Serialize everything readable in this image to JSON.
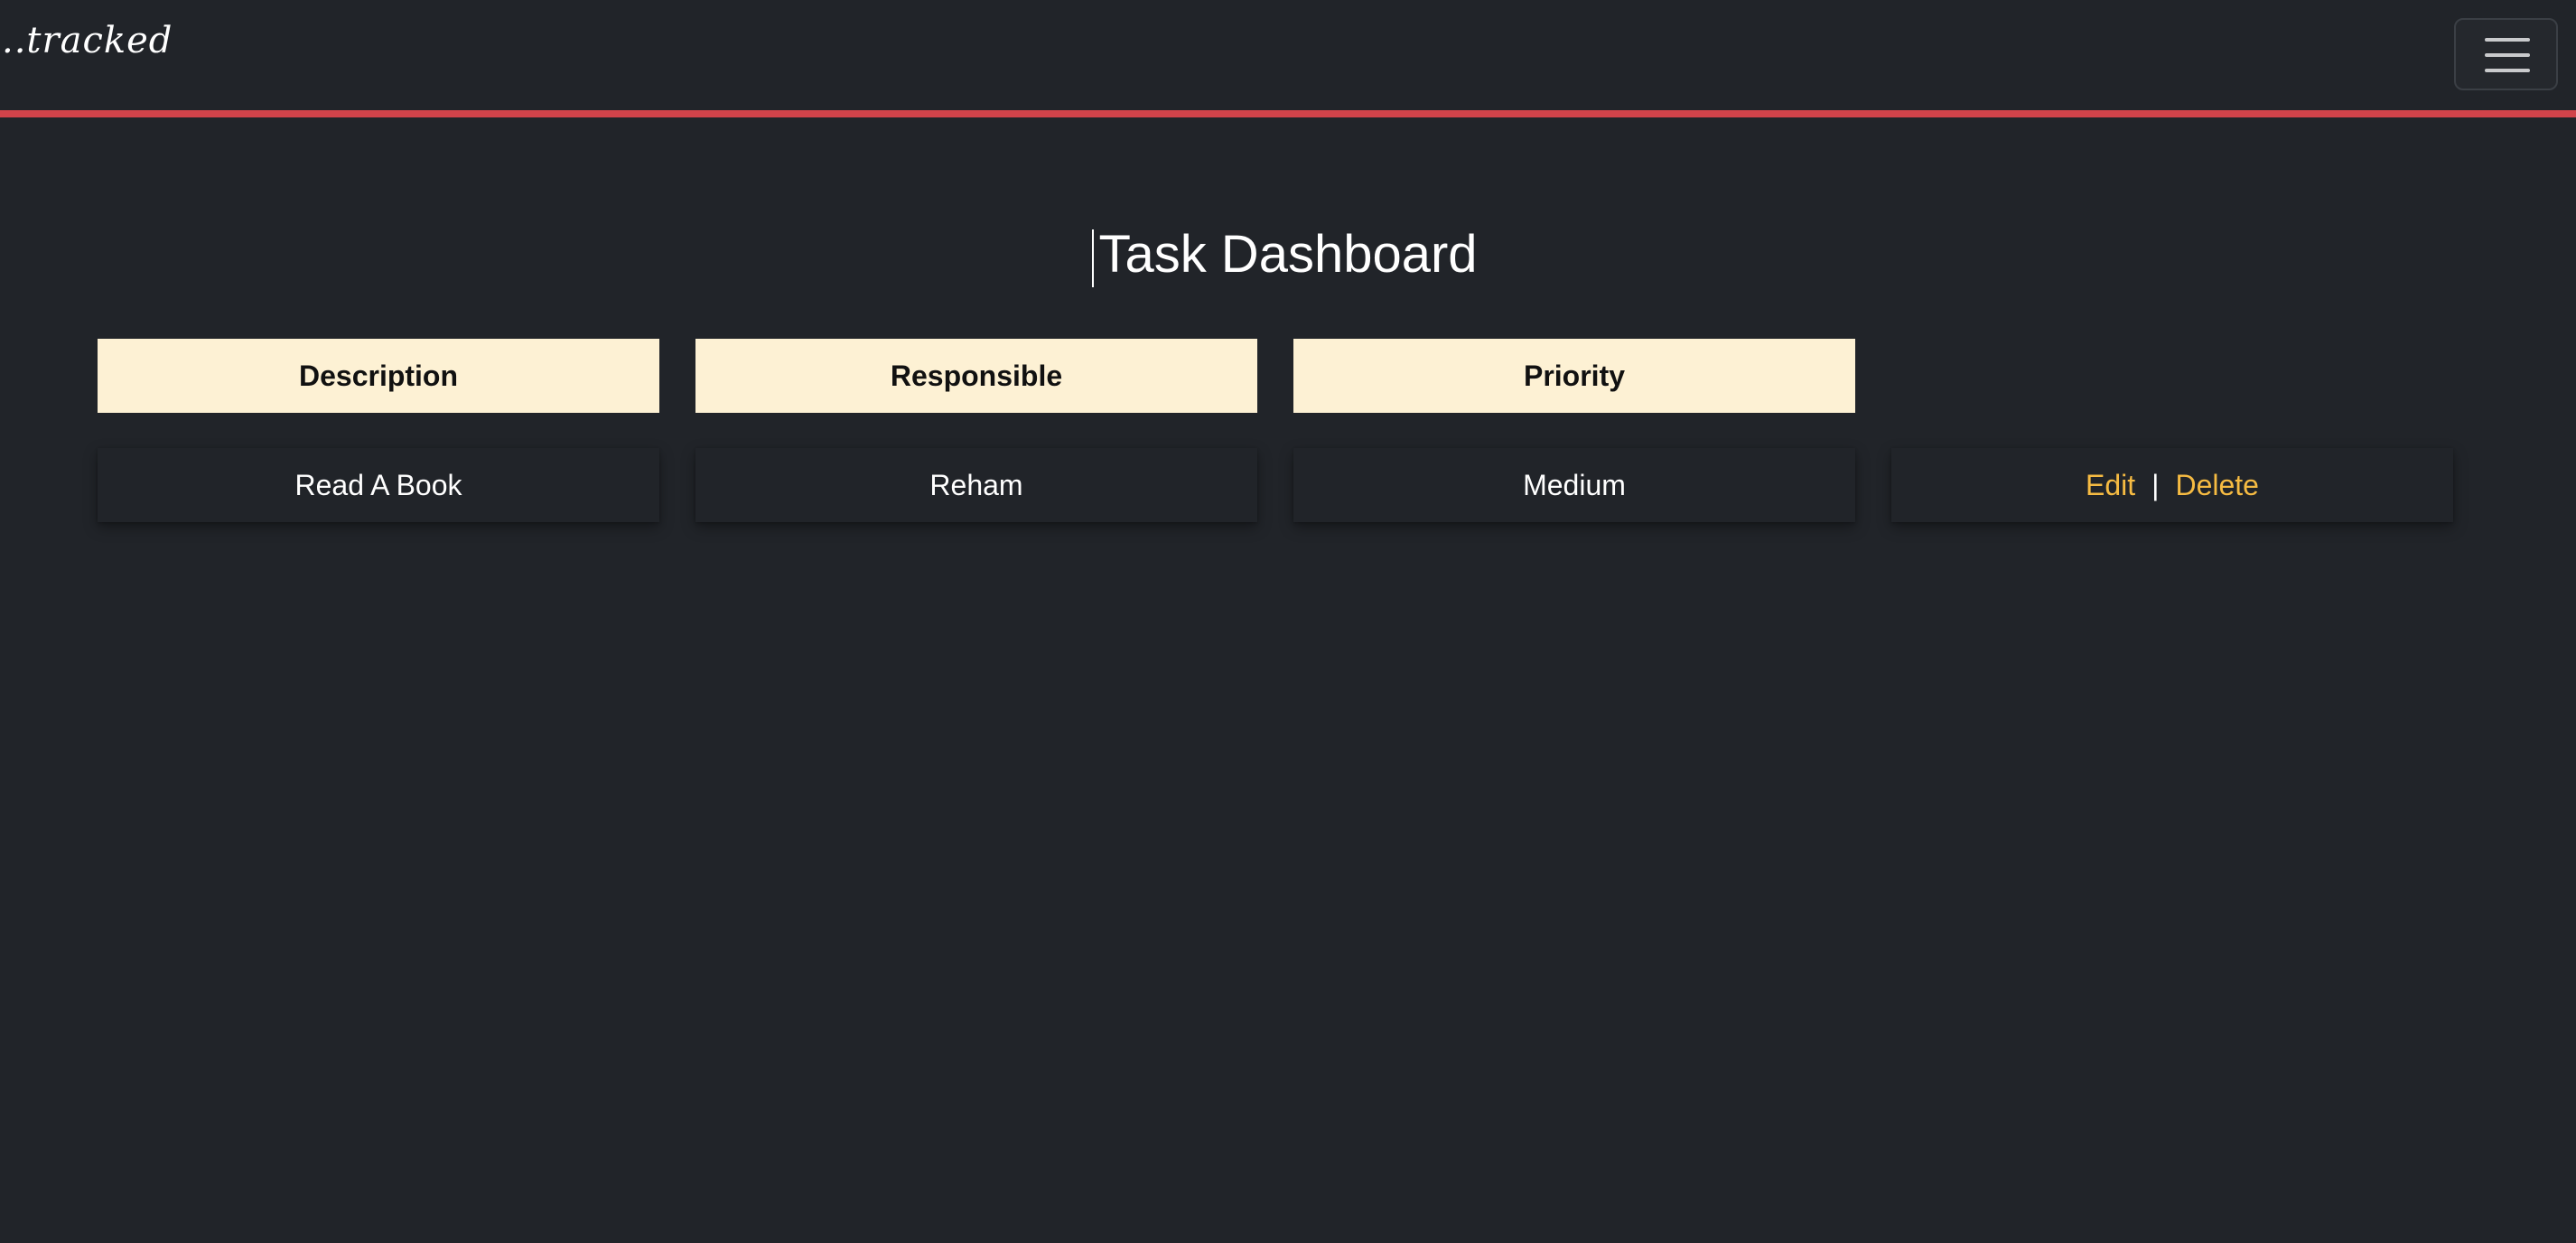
{
  "navbar": {
    "brand": "..tracked",
    "menu_icon": "hamburger-menu-icon"
  },
  "colors": {
    "background": "#212429",
    "accent_line": "#d1434a",
    "header_bg": "#fdf1d4",
    "link": "#f6bb42"
  },
  "page": {
    "title": "Task Dashboard"
  },
  "table": {
    "columns": [
      "Description",
      "Responsible",
      "Priority"
    ],
    "rows": [
      {
        "description": "Read A Book",
        "responsible": "Reham",
        "priority": "Medium",
        "edit_label": "Edit",
        "separator": "|",
        "delete_label": "Delete"
      }
    ]
  }
}
